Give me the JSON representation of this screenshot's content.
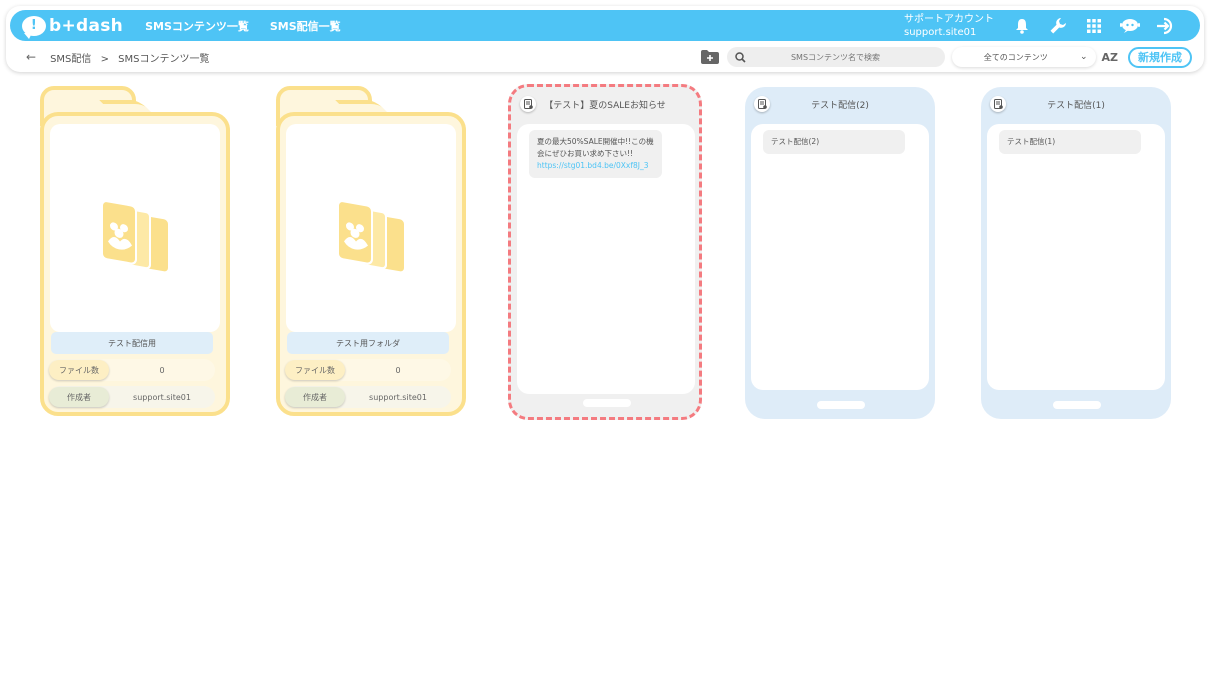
{
  "app": {
    "logo_text": "b+dash",
    "nav": [
      "SMSコンテンツ一覧",
      "SMS配信一覧"
    ],
    "account_label": "サポートアカウント",
    "account_name": "support.site01",
    "accent_color": "#4ec4f5"
  },
  "icons": [
    "bell-icon",
    "wrench-icon",
    "grid-icon",
    "chat-bot-icon",
    "logout-icon"
  ],
  "breadcrumb": {
    "back": "←",
    "items": [
      "SMS配信",
      ">",
      "SMSコンテンツ一覧"
    ]
  },
  "toolbar": {
    "search_placeholder": "SMSコンテンツ名で検索",
    "filter_value": "全てのコンテンツ",
    "sort_label": "AZ",
    "new_button": "新規作成"
  },
  "folders": [
    {
      "name": "テスト配信用",
      "count_label": "ファイル数",
      "count": "0",
      "author_label": "作成者",
      "author": "support.site01"
    },
    {
      "name": "テスト用フォルダ",
      "count_label": "ファイル数",
      "count": "0",
      "author_label": "作成者",
      "author": "support.site01"
    }
  ],
  "contents": [
    {
      "title": "【テスト】夏のSALEお知らせ",
      "message_line1": "夏の最大50%SALE開催中!!この機",
      "message_line2": "会にぜひお買い求め下さい!!",
      "link": "https://stg01.bd4.be/0Xxf8J_3",
      "selected": true
    },
    {
      "title": "テスト配信(2)",
      "message_line1": "テスト配信(2)",
      "selected": false
    },
    {
      "title": "テスト配信(1)",
      "message_line1": "テスト配信(1)",
      "selected": false
    }
  ]
}
